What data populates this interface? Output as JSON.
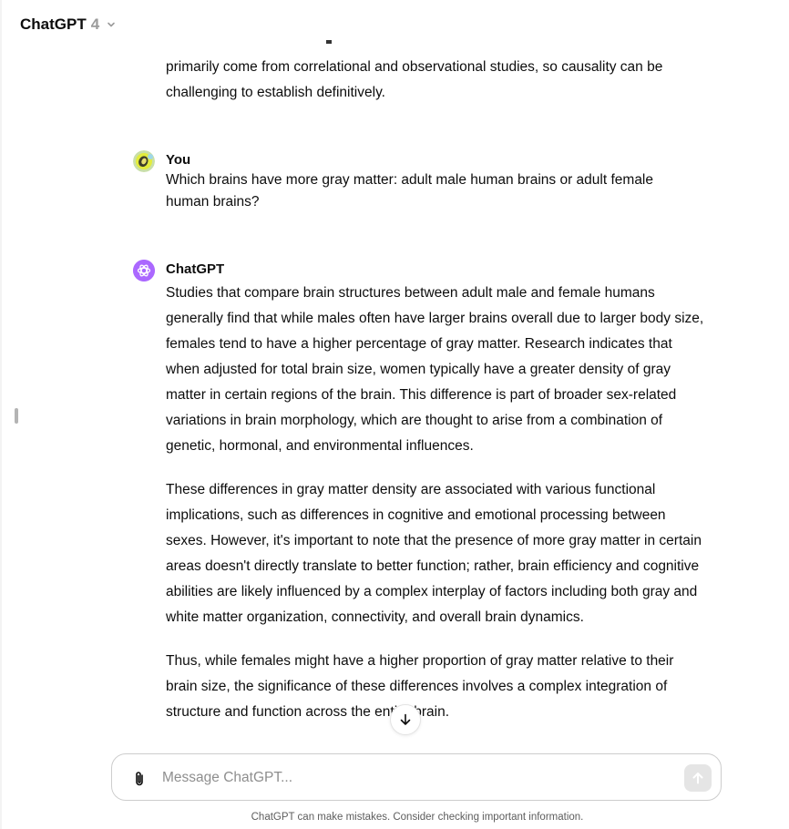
{
  "header": {
    "title": "ChatGPT",
    "version": "4",
    "chevron_icon": "chevron-down-icon"
  },
  "thread": {
    "previous_response_fragment": "primarily come from correlational and observational studies, so causality can be challenging to establish definitively.",
    "user_message": {
      "author": "You",
      "avatar_icon": "user-avatar",
      "text": "Which brains have more gray matter: adult male human brains or adult female human brains?"
    },
    "assistant_message": {
      "author": "ChatGPT",
      "avatar_icon": "openai-logo-icon",
      "avatar_color": "#ab68ff",
      "paragraphs": [
        "Studies that compare brain structures between adult male and female humans generally find that while males often have larger brains overall due to larger body size, females tend to have a higher percentage of gray matter. Research indicates that when adjusted for total brain size, women typically have a greater density of gray matter in certain regions of the brain. This difference is part of broader sex-related variations in brain morphology, which are thought to arise from a combination of genetic, hormonal, and environmental influences.",
        "These differences in gray matter density are associated with various functional implications, such as differences in cognitive and emotional processing between sexes. However, it's important to note that the presence of more gray matter in certain areas doesn't directly translate to better function; rather, brain efficiency and cognitive abilities are likely influenced by a complex interplay of factors including both gray and white matter organization, connectivity, and overall brain dynamics.",
        "Thus, while females might have a higher proportion of gray matter relative to their brain size, the significance of these differences involves a complex integration of structure and function across the entire brain."
      ]
    }
  },
  "composer": {
    "placeholder": "Message ChatGPT...",
    "value": "",
    "attach_icon": "paperclip-icon",
    "send_icon": "arrow-up-icon"
  },
  "scroll_button_icon": "arrow-down-icon",
  "disclaimer": "ChatGPT can make mistakes. Consider checking important information."
}
